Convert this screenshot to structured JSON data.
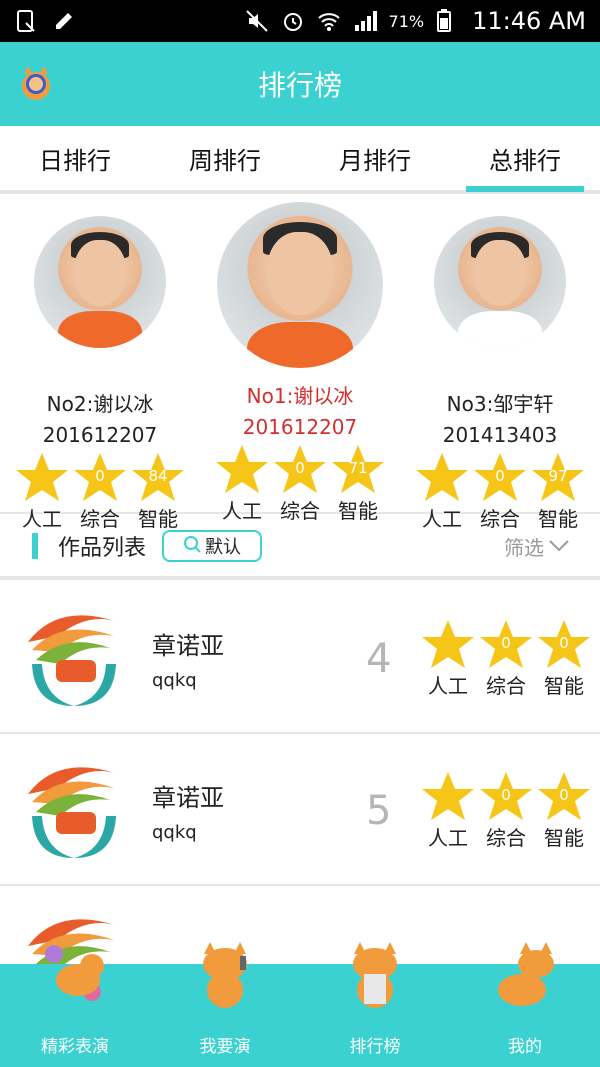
{
  "status_bar": {
    "battery": "71%",
    "time": "11:46 AM"
  },
  "app_bar": {
    "title": "排行榜"
  },
  "tabs": [
    {
      "label": "日排行",
      "active": false
    },
    {
      "label": "周排行",
      "active": false
    },
    {
      "label": "月排行",
      "active": false
    },
    {
      "label": "总排行",
      "active": true
    }
  ],
  "ranking": [
    {
      "rank_text": "No2:谢以冰",
      "id": "201612207",
      "stars": [
        "",
        "0",
        "84"
      ],
      "shirt": "#ef6a2a"
    },
    {
      "rank_text": "No1:谢以冰",
      "id": "201612207",
      "stars": [
        "",
        "0",
        "71"
      ],
      "shirt": "#ef6a2a"
    },
    {
      "rank_text": "No3:邹宇轩",
      "id": "201413403",
      "stars": [
        "",
        "0",
        "97"
      ],
      "shirt": "#ffffff"
    }
  ],
  "star_labels": [
    "人工",
    "综合",
    "智能"
  ],
  "works": {
    "title": "作品列表",
    "sort_label": "默认",
    "filter_label": "筛选"
  },
  "work_rows": [
    {
      "name": "章诺亚",
      "account": "qqkq",
      "rank": "4",
      "stars": [
        "",
        "0",
        "0"
      ]
    },
    {
      "name": "章诺亚",
      "account": "qqkq",
      "rank": "5",
      "stars": [
        "",
        "0",
        "0"
      ]
    }
  ],
  "bottom_nav": [
    {
      "label": "精彩表演",
      "icon": "cat-performance-icon"
    },
    {
      "label": "我要演",
      "icon": "cat-perform-icon"
    },
    {
      "label": "排行榜",
      "icon": "cat-ranking-icon"
    },
    {
      "label": "我的",
      "icon": "cat-profile-icon"
    }
  ],
  "colors": {
    "accent": "#3bd1d0",
    "star": "#f5c518",
    "red": "#d23030"
  }
}
